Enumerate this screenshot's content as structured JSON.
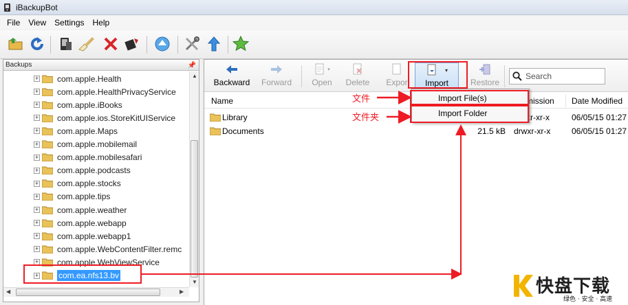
{
  "window": {
    "title": "iBackupBot"
  },
  "menu": [
    "File",
    "View",
    "Settings",
    "Help"
  ],
  "left_pane": {
    "header": "Backups",
    "pin_glyph": "ᵰ",
    "items": [
      "com.apple.Health",
      "com.apple.HealthPrivacyService",
      "com.apple.iBooks",
      "com.apple.ios.StoreKitUIService",
      "com.apple.Maps",
      "com.apple.mobilemail",
      "com.apple.mobilesafari",
      "com.apple.podcasts",
      "com.apple.stocks",
      "com.apple.tips",
      "com.apple.weather",
      "com.apple.webapp",
      "com.apple.webapp1",
      "com.apple.WebContentFilter.remc",
      "com.apple.WebViewService",
      "com.ea.nfs13.bv"
    ],
    "selected_index": 15,
    "expander_glyph": "+"
  },
  "file_toolbar": {
    "backward": "Backward",
    "forward": "Forward",
    "open": "Open",
    "delete": "Delete",
    "export": "Expor",
    "import": "Import",
    "restore": "Restore",
    "search_placeholder": "Search"
  },
  "columns": {
    "name": "Name",
    "permission": "mission",
    "date_modified": "Date Modified"
  },
  "files": [
    {
      "name": "Library",
      "size": "",
      "permission": "xr-xr-x",
      "date": "06/05/15 01:27"
    },
    {
      "name": "Documents",
      "size": "21.5 kB",
      "permission": "drwxr-xr-x",
      "date": "06/05/15 01:27"
    }
  ],
  "import_menu": [
    "Import File(s)",
    "Import Folder"
  ],
  "annotations": {
    "file_label": "文件",
    "folder_label": "文件夹",
    "color": "#ee1b24"
  },
  "watermark": {
    "brand": "快盘下载",
    "slogan": "绿色 · 安全 · 高速"
  }
}
